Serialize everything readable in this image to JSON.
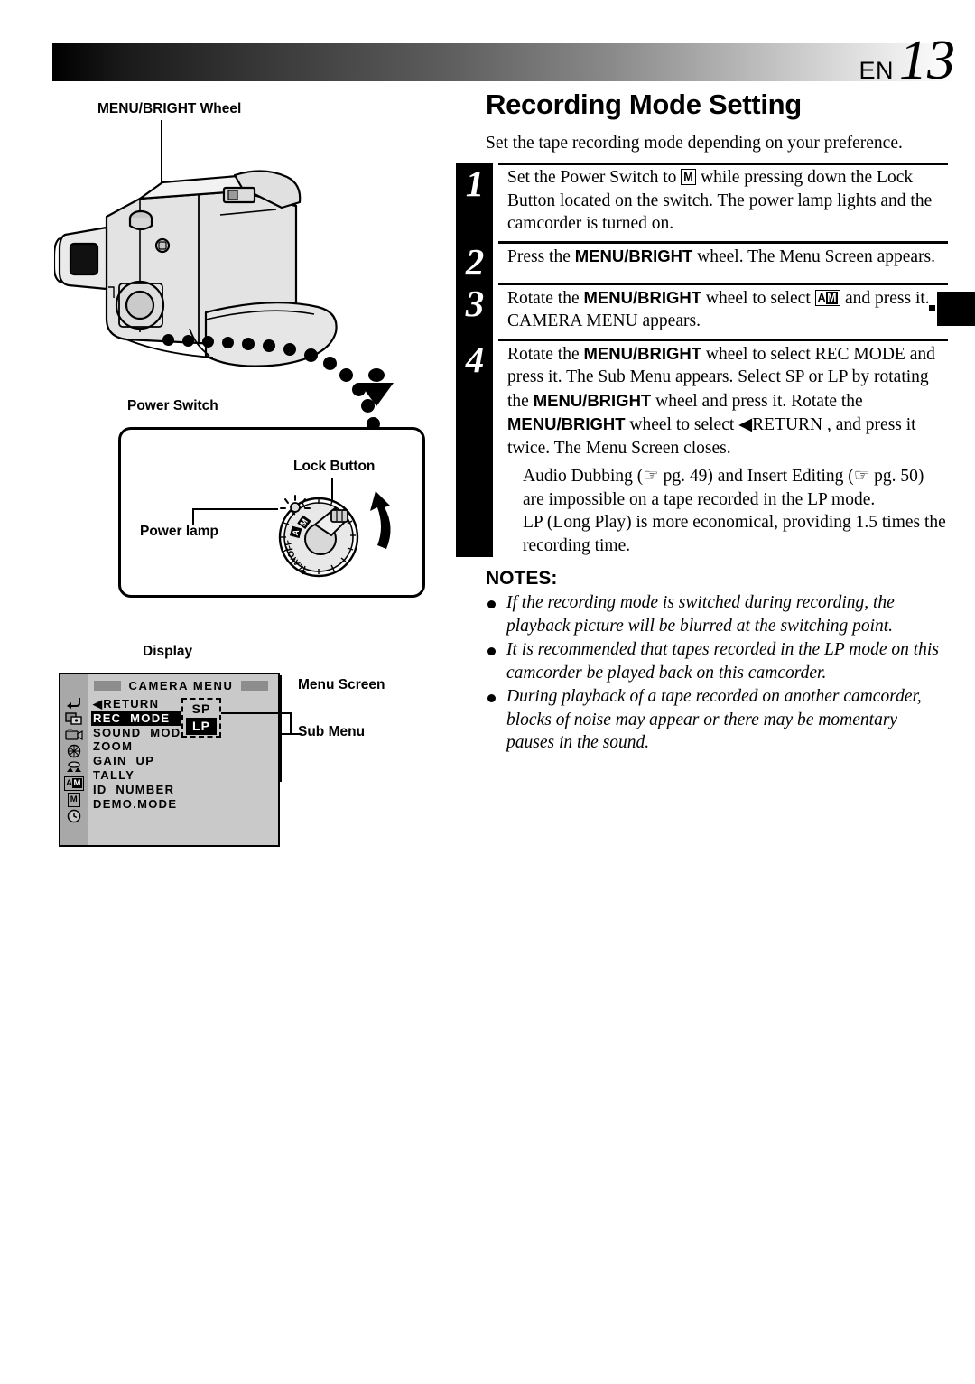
{
  "page": {
    "lang_code": "EN",
    "number": "13"
  },
  "left": {
    "wheel_label": "MENU/BRIGHT Wheel",
    "power_switch_label": "Power Switch",
    "lock_button_label": "Lock Button",
    "power_lamp_label": "Power lamp",
    "display_label": "Display",
    "menu_screen_label": "Menu Screen",
    "sub_menu_label": "Sub Menu",
    "dial_positions": [
      "M",
      "A",
      "OFF",
      "PLAY"
    ],
    "menu_screen": {
      "title": "CAMERA  MENU",
      "items": [
        {
          "label": "◀RETURN",
          "selected": false
        },
        {
          "label": "REC  MODE",
          "selected": true
        },
        {
          "label": "SOUND  MODE",
          "selected": false
        },
        {
          "label": "ZOOM",
          "selected": false
        },
        {
          "label": "GAIN  UP",
          "selected": false
        },
        {
          "label": "TALLY",
          "selected": false
        },
        {
          "label": "ID  NUMBER",
          "selected": false
        },
        {
          "label": "DEMO.MODE",
          "selected": false
        }
      ],
      "rail_icons": [
        "return-arrow-icon",
        "dubbing-icon",
        "camera-icon",
        "effects-icon",
        "manual-exposure-icon",
        "camera-menu-am-icon",
        "manual-m-icon",
        "clock-icon"
      ],
      "rail_selected_index": 5,
      "sub_menu": {
        "options": [
          {
            "label": "SP",
            "selected": false
          },
          {
            "label": "LP",
            "selected": true
          }
        ]
      }
    }
  },
  "main": {
    "title": "Recording Mode Setting",
    "intro": "Set the tape recording mode depending on your preference.",
    "steps": [
      {
        "number": "1",
        "parts": [
          {
            "t": "text",
            "v": "Set the Power Switch to "
          },
          {
            "t": "glyph",
            "v": "M",
            "style": "box"
          },
          {
            "t": "text",
            "v": " while pressing down the Lock Button located on the switch. The power lamp lights and the camcorder is turned on."
          }
        ]
      },
      {
        "number": "2",
        "parts": [
          {
            "t": "text",
            "v": "Press the "
          },
          {
            "t": "bold",
            "v": "MENU/BRIGHT"
          },
          {
            "t": "text",
            "v": " wheel. The Menu Screen appears."
          }
        ]
      },
      {
        "number": "3",
        "parts": [
          {
            "t": "text",
            "v": "Rotate the "
          },
          {
            "t": "bold",
            "v": "MENU/BRIGHT"
          },
          {
            "t": "text",
            "v": " wheel to select "
          },
          {
            "t": "glyph",
            "v": "AM",
            "style": "box-half-inverted"
          },
          {
            "t": "text",
            "v": " and press it. CAMERA MENU appears."
          }
        ]
      },
      {
        "number": "4",
        "parts": [
          {
            "t": "text",
            "v": "Rotate the "
          },
          {
            "t": "bold",
            "v": "MENU/BRIGHT"
          },
          {
            "t": "text",
            "v": " wheel to select REC MODE and press it. The Sub Menu appears. Select SP or LP by rotating the "
          },
          {
            "t": "bold",
            "v": "MENU/BRIGHT"
          },
          {
            "t": "text",
            "v": " wheel and press it. Rotate the "
          },
          {
            "t": "bold",
            "v": "MENU/BRIGHT"
          },
          {
            "t": "text",
            "v": " wheel to select ◀RETURN , and press it twice. The Menu Screen closes."
          }
        ],
        "sub_notes": [
          "Audio Dubbing (☞ pg. 49) and Insert Editing (☞ pg. 50) are impossible on a tape recorded in the LP mode.",
          "LP (Long Play) is more economical, providing 1.5 times the recording time."
        ]
      }
    ],
    "notes_title": "NOTES:",
    "notes": [
      "If the recording mode is switched during recording, the playback picture will be blurred at the switching point.",
      "It is recommended that tapes recorded in the LP mode on this camcorder be played back on this camcorder.",
      "During playback of a tape recorded on another camcorder, blocks of noise may appear or there may be momentary pauses in the sound."
    ]
  }
}
